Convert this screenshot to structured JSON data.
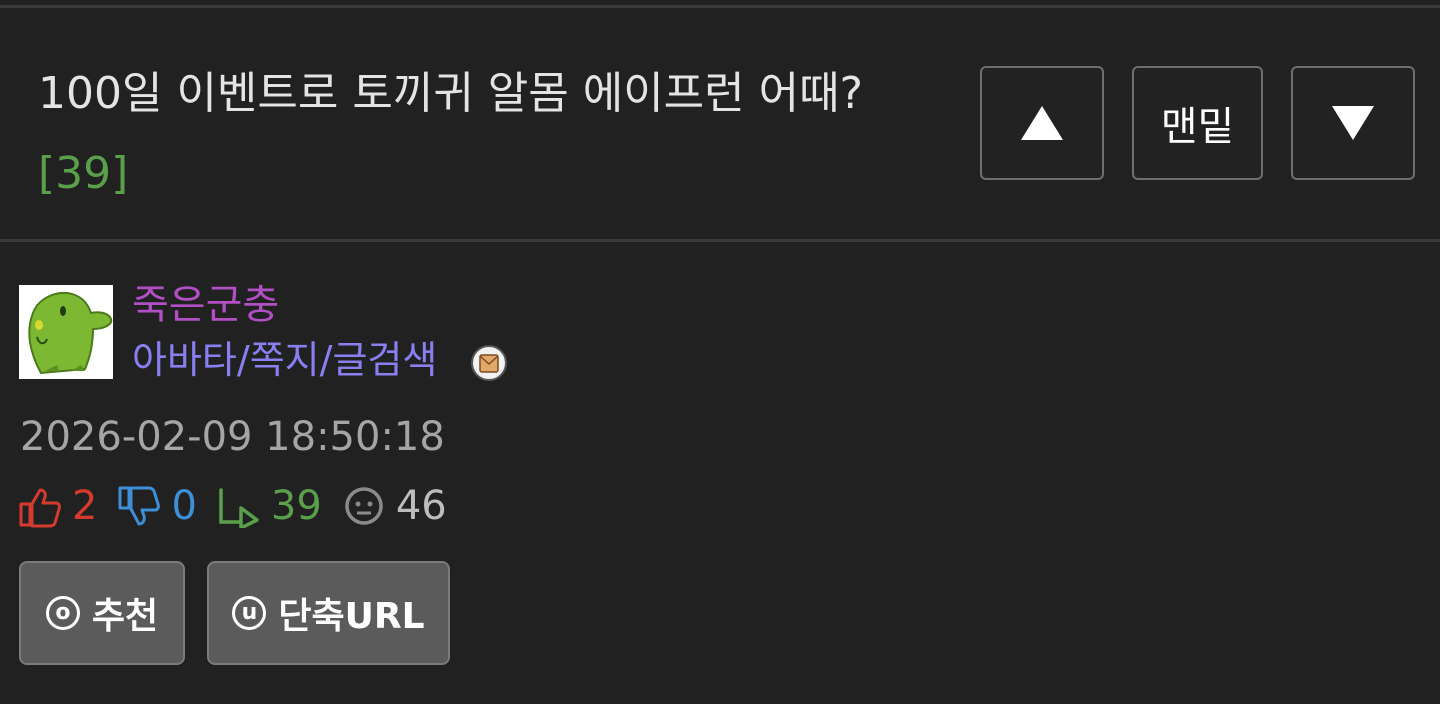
{
  "post": {
    "title": "100일 이벤트로 토끼귀 알몸 에이프런 어때?",
    "comment_count": "[39]"
  },
  "nav": {
    "up_icon": "triangle-up-icon",
    "bottom_label": "맨밑",
    "down_icon": "triangle-down-icon"
  },
  "author": {
    "name": "죽은군충",
    "name_color": "#b14fc4",
    "link_avatar": "아바타",
    "link_message": "쪽지",
    "link_search": "글검색",
    "separator": "/",
    "badge_icon": "envelope-badge-icon"
  },
  "meta": {
    "datetime": "2026-02-09 18:50:18"
  },
  "stats": {
    "upvotes": "2",
    "downvotes": "0",
    "replies": "39",
    "views": "46",
    "colors": {
      "up": "#d43b2e",
      "down": "#3d8fd6",
      "reply": "#5aa04a",
      "view": "#bdbdbd"
    }
  },
  "actions": {
    "recommend_icon_char": "o",
    "recommend_label": "추천",
    "shorturl_icon_char": "u",
    "shorturl_label": "단축URL"
  }
}
